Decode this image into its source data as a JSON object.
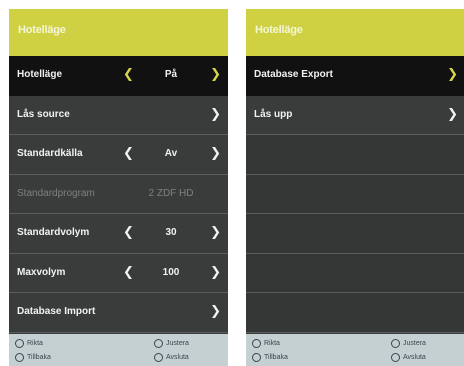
{
  "left": {
    "title": "Hotelläge",
    "rows": [
      {
        "label": "Hotelläge",
        "value": "På",
        "arrow_left": "❮",
        "arrow_right": "❯"
      },
      {
        "label": "Lås source",
        "arrow_right": "❯"
      },
      {
        "label": "Standardkälla",
        "value": "Av",
        "arrow_left": "❮",
        "arrow_right": "❯"
      },
      {
        "label": "Standardprogram",
        "value": "2 ZDF HD"
      },
      {
        "label": "Standardvolym",
        "value": "30",
        "arrow_left": "❮",
        "arrow_right": "❯"
      },
      {
        "label": "Maxvolym",
        "value": "100",
        "arrow_left": "❮",
        "arrow_right": "❯"
      },
      {
        "label": "Database Import",
        "arrow_right": "❯"
      }
    ],
    "footer": {
      "h1": "Rikta",
      "h2": "Tillbaka",
      "h3": "Justera",
      "h4": "Avsluta"
    }
  },
  "right": {
    "title": "Hotelläge",
    "rows": [
      {
        "label": "Database Export",
        "arrow_right": "❯"
      },
      {
        "label": "Lås upp",
        "arrow_right": "❯"
      }
    ],
    "footer": {
      "h1": "Rikta",
      "h2": "Tillbaka",
      "h3": "Justera",
      "h4": "Avsluta"
    }
  }
}
